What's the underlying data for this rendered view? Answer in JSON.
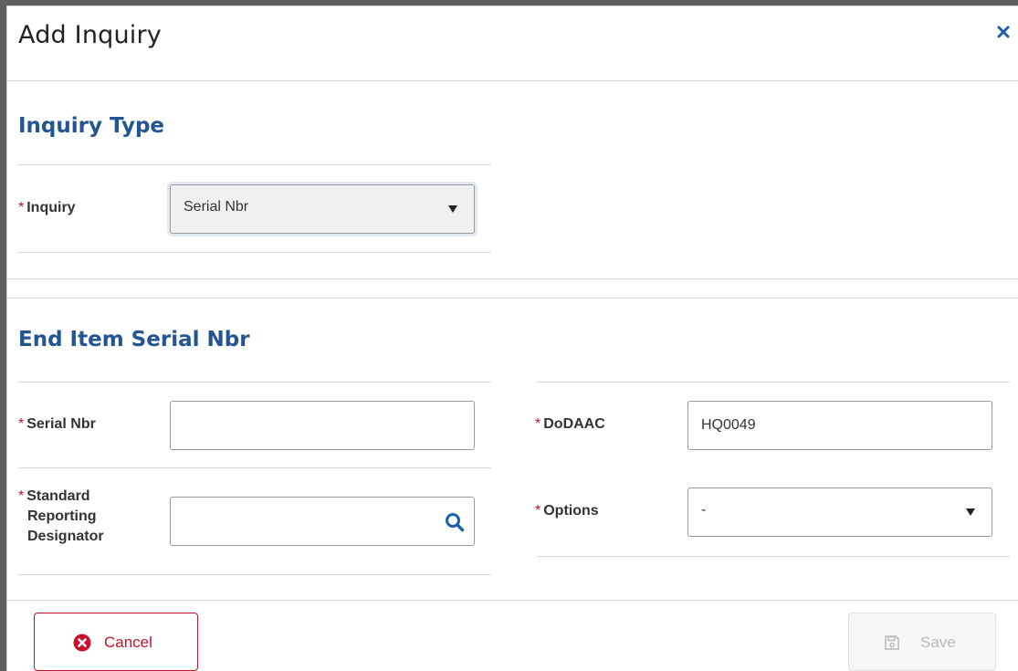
{
  "dialog": {
    "title": "Add Inquiry",
    "close_icon": "close-icon"
  },
  "inquiry_type": {
    "section_title": "Inquiry Type",
    "inquiry_label": "Inquiry",
    "inquiry_value": "Serial Nbr"
  },
  "end_item": {
    "section_title": "End Item Serial Nbr",
    "serial_label": "Serial Nbr",
    "serial_value": "",
    "dodaac_label": "DoDAAC",
    "dodaac_value": "HQ0049",
    "srd_label_line1": "Standard",
    "srd_label_line2": "Reporting",
    "srd_label_line3": "Designator",
    "srd_value": "",
    "srd_icon": "search-icon",
    "options_label": "Options",
    "options_value": "-"
  },
  "footer": {
    "cancel_label": "Cancel",
    "save_label": "Save"
  },
  "colors": {
    "section_title": "#245593",
    "required": "#c8102e",
    "cancel": "#c8102e",
    "search_icon": "#1f5fa8"
  }
}
